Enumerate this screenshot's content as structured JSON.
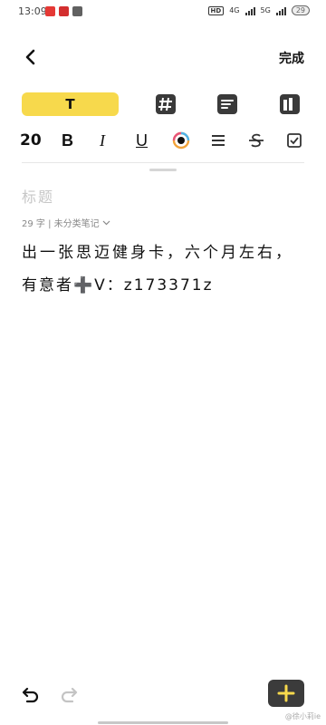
{
  "status": {
    "time": "13:09",
    "hd": "HD",
    "network1": "4G",
    "network2": "5G",
    "battery": "29"
  },
  "toolbar": {
    "done_label": "完成",
    "text_tab_label": "T",
    "font_size": "20",
    "bold": "B",
    "italic": "I",
    "underline": "U"
  },
  "editor": {
    "title_placeholder": "标题",
    "meta": "29 字 | 未分类笔记",
    "body_line1": "出一张思迈健身卡，六个月左右，",
    "body_line2": "有意者➕V：z173371z"
  },
  "watermark": "@徐小莉ie",
  "colors": {
    "accent": "#f7d94c",
    "dark": "#3b3b3b"
  }
}
